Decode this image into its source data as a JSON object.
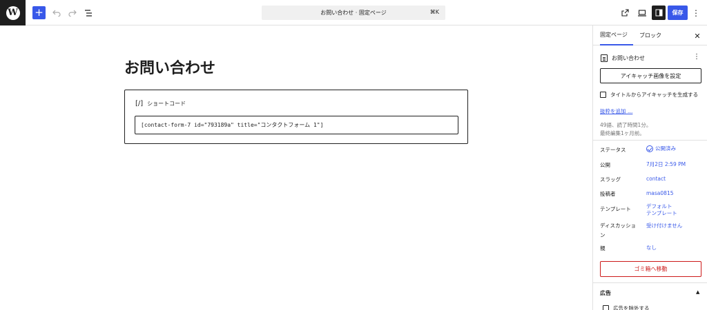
{
  "topbar": {
    "logo_letter": "W",
    "add_symbol": "+",
    "command_title": "お問い合わせ · 固定ページ",
    "command_shortcut": "⌘K",
    "save_label": "保存"
  },
  "editor": {
    "post_title": "お問い合わせ",
    "block_label": "ショートコード",
    "block_icon_text": "[/]",
    "shortcode_value": "[contact-form-7 id=\"793189a\" title=\"コンタクトフォーム 1\"]"
  },
  "sidebar": {
    "tabs": [
      {
        "label": "固定ページ",
        "active": true
      },
      {
        "label": "ブロック",
        "active": false
      }
    ],
    "doc_title": "お問い合わせ",
    "featured_image_button": "アイキャッチ画像を設定",
    "generate_featured_label": "タイトルからアイキャッチを生成する",
    "excerpt_link": "抜粋を追加 …",
    "word_count": "49語、読了時間1分。",
    "last_edited": "最終編集1ヶ月前。",
    "properties": [
      {
        "label": "ステータス",
        "value": "公開済み"
      },
      {
        "label": "公開",
        "value": "7月2日 2:59 PM"
      },
      {
        "label": "スラッグ",
        "value": "contact"
      },
      {
        "label": "投稿者",
        "value": "masa0815"
      },
      {
        "label": "テンプレート",
        "value_line1": "デフォルト",
        "value_line2": "テンプレート"
      },
      {
        "label_line1": "ディスカッショ",
        "label_line2": "ン",
        "value": "受け付けません"
      },
      {
        "label": "親",
        "value": "なし"
      }
    ],
    "trash_button": "ゴミ箱へ移動",
    "ads_section_title": "広告",
    "ads_checkbox_label": "広告を除外する"
  },
  "colors": {
    "accent": "#3858e9",
    "danger": "#cc1818",
    "dark": "#1e1e1e"
  }
}
